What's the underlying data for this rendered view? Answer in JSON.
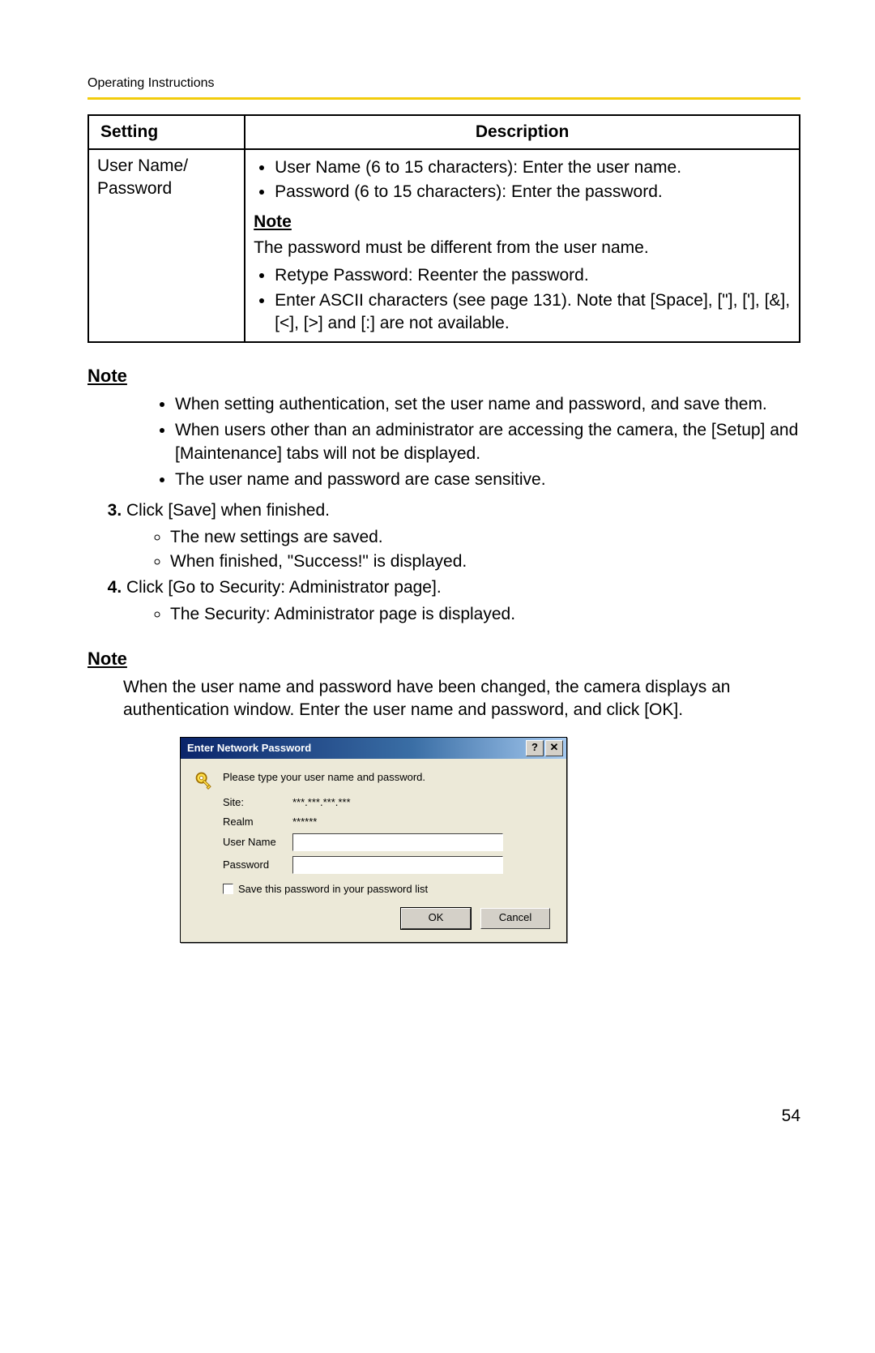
{
  "header": "Operating Instructions",
  "table": {
    "headers": {
      "setting": "Setting",
      "description": "Description"
    },
    "row": {
      "setting": "User Name/\nPassword",
      "desc_bullets_a": [
        "User Name (6 to 15 characters): Enter the user name.",
        "Password (6 to 15 characters): Enter the password."
      ],
      "note_heading": "Note",
      "note_text": "The password must be different from the user name.",
      "desc_bullets_b": [
        "Retype Password: Reenter the password.",
        "Enter ASCII characters (see page 131). Note that [Space], [\"], ['], [&], [<], [>] and [:] are not available."
      ]
    }
  },
  "note1_heading": "Note",
  "note1_bullets": [
    "When setting authentication, set the user name and password, and save them.",
    "When users other than an administrator are accessing the camera, the [Setup] and [Maintenance] tabs will not be displayed.",
    "The user name and password are case sensitive."
  ],
  "step3": {
    "text": "Click [Save] when finished.",
    "sub": [
      "The new settings are saved.",
      "When finished, \"Success!\" is displayed."
    ]
  },
  "step4": {
    "text": "Click [Go to Security: Administrator page].",
    "sub": [
      "The Security: Administrator page is displayed."
    ]
  },
  "note2_heading": "Note",
  "note2_text": "When the user name and password have been changed, the camera displays an authentication window. Enter the user name and password, and click [OK].",
  "dialog": {
    "title": "Enter Network Password",
    "help_btn": "?",
    "close_btn": "✕",
    "prompt": "Please type your user name and password.",
    "fields": {
      "site_label": "Site:",
      "site_value": "***.***.***.***",
      "realm_label": "Realm",
      "realm_value": "******",
      "user_label": "User Name",
      "user_value": "",
      "pass_label": "Password",
      "pass_value": ""
    },
    "checkbox_label": "Save this password in your password list",
    "ok": "OK",
    "cancel": "Cancel"
  },
  "page_number": "54"
}
